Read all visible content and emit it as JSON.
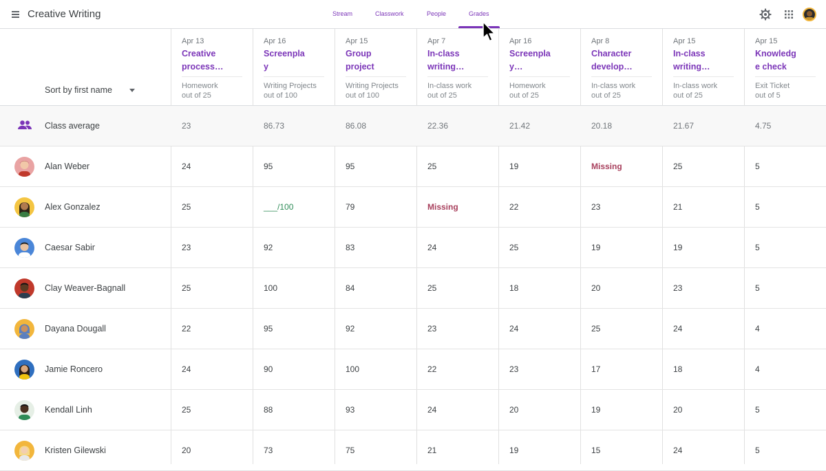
{
  "app": {
    "title": "Creative Writing"
  },
  "tabs": [
    {
      "label": "Stream"
    },
    {
      "label": "Classwork"
    },
    {
      "label": "People"
    },
    {
      "label": "Grades"
    }
  ],
  "active_tab": "Grades",
  "icons": {
    "menu": "hamburger-menu-icon",
    "settings": "gear-icon",
    "apps": "apps-grid-icon",
    "class_average": "people-group-icon",
    "cursor": "mouse-pointer-icon"
  },
  "colors": {
    "accent": "#7b35b8",
    "missing": "#a8405d",
    "draft": "#2e8b57"
  },
  "sort": {
    "label": "Sort by first name"
  },
  "assignments": [
    {
      "date": "Apr 13",
      "title_1": "Creative",
      "title_2": "process…",
      "category": "Homework",
      "points": "out of 25"
    },
    {
      "date": "Apr 16",
      "title_1": "Screenpla",
      "title_2": "y",
      "category": "Writing Projects",
      "points": "out of 100"
    },
    {
      "date": "Apr 15",
      "title_1": "Group",
      "title_2": "project",
      "category": "Writing Projects",
      "points": "out of 100"
    },
    {
      "date": "Apr 7",
      "title_1": "In-class",
      "title_2": "writing…",
      "category": "In-class work",
      "points": "out of 25"
    },
    {
      "date": "Apr 16",
      "title_1": "Screenpla",
      "title_2": "y…",
      "category": "Homework",
      "points": "out of 25"
    },
    {
      "date": "Apr 8",
      "title_1": "Character",
      "title_2": "develop…",
      "category": "In-class work",
      "points": "out of 25"
    },
    {
      "date": "Apr 15",
      "title_1": "In-class",
      "title_2": "writing…",
      "category": "In-class work",
      "points": "out of 25"
    },
    {
      "date": "Apr 15",
      "title_1": "Knowledg",
      "title_2": "e check",
      "category": "Exit Ticket",
      "points": "out of 5"
    }
  ],
  "class_average": {
    "label": "Class average",
    "values": [
      "23",
      "86.73",
      "86.08",
      "22.36",
      "21.42",
      "20.18",
      "21.67",
      "4.75"
    ]
  },
  "students": [
    {
      "name": "Alan Weber",
      "grades": [
        "24",
        "95",
        "95",
        "25",
        "19",
        "Missing",
        "25",
        "5"
      ]
    },
    {
      "name": "Alex Gonzalez",
      "grades": [
        "25",
        "___/100",
        "79",
        "Missing",
        "22",
        "23",
        "21",
        "5"
      ]
    },
    {
      "name": "Caesar Sabir",
      "grades": [
        "23",
        "92",
        "83",
        "24",
        "25",
        "19",
        "19",
        "5"
      ]
    },
    {
      "name": "Clay Weaver-Bagnall",
      "grades": [
        "25",
        "100",
        "84",
        "25",
        "18",
        "20",
        "23",
        "5"
      ]
    },
    {
      "name": "Dayana Dougall",
      "grades": [
        "22",
        "95",
        "92",
        "23",
        "24",
        "25",
        "24",
        "4"
      ]
    },
    {
      "name": "Jamie Roncero",
      "grades": [
        "24",
        "90",
        "100",
        "22",
        "23",
        "17",
        "18",
        "4"
      ]
    },
    {
      "name": "Kendall Linh",
      "grades": [
        "25",
        "88",
        "93",
        "24",
        "20",
        "19",
        "20",
        "5"
      ]
    },
    {
      "name": "Kristen Gilewski",
      "grades": [
        "20",
        "73",
        "75",
        "21",
        "19",
        "15",
        "24",
        "5"
      ]
    }
  ]
}
